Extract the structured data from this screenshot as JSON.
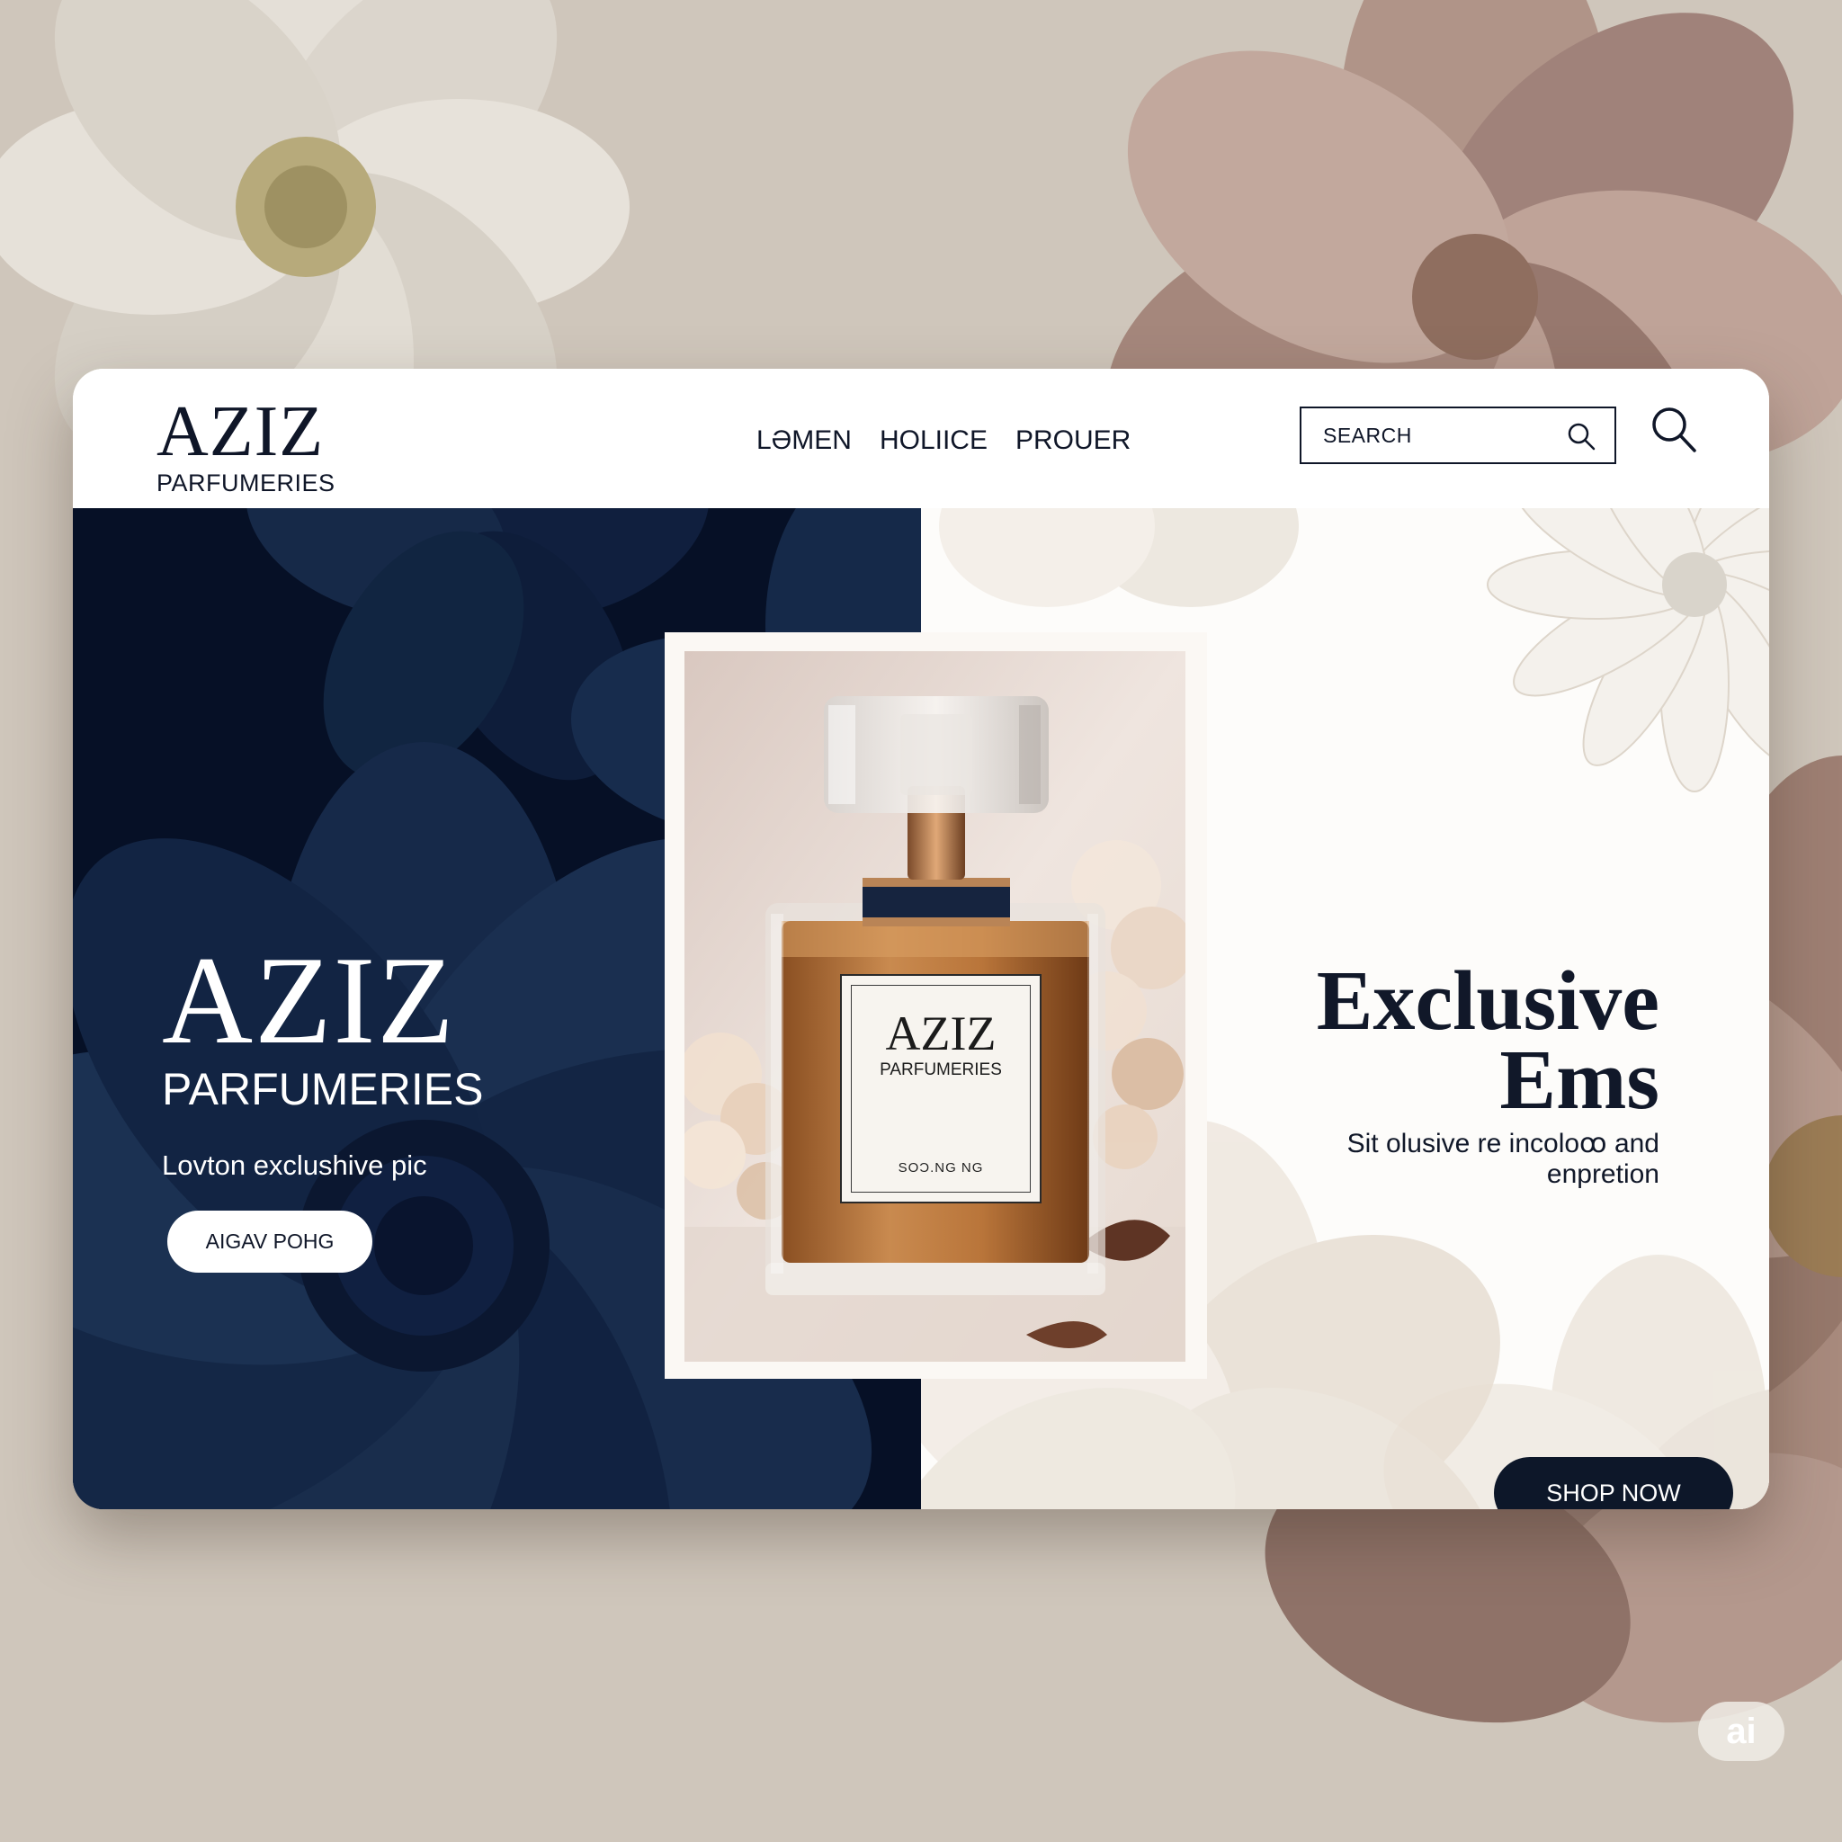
{
  "header": {
    "logo_title": "AZIZ",
    "logo_subtitle": "PARFUMERIES",
    "nav": [
      "LƏMEN",
      "HOLIICE",
      "PROUER"
    ],
    "search_placeholder": "SEARCH"
  },
  "hero_left": {
    "title": "AZIZ",
    "subtitle": "PARFUMERIES",
    "tagline": "Lovton exclushive pic",
    "button_label": "AIGAV POHG"
  },
  "product": {
    "label_title": "AZIZ",
    "label_subtitle": "PARFUMERIES",
    "label_note": "SOƆ.NG NG"
  },
  "hero_right": {
    "title_line1": "Exclusive",
    "title_line2": "Ems",
    "description": "Sit olusive re incoloꝏ and enpretion",
    "button_label": "SHOP NOW"
  },
  "badge": "ai",
  "colors": {
    "navy": "#061026",
    "button_dark": "#0d1729",
    "background": "#cfc6bb",
    "perfume_amber": "#b9753a"
  },
  "icons": [
    "search-icon",
    "magnifier-icon"
  ]
}
